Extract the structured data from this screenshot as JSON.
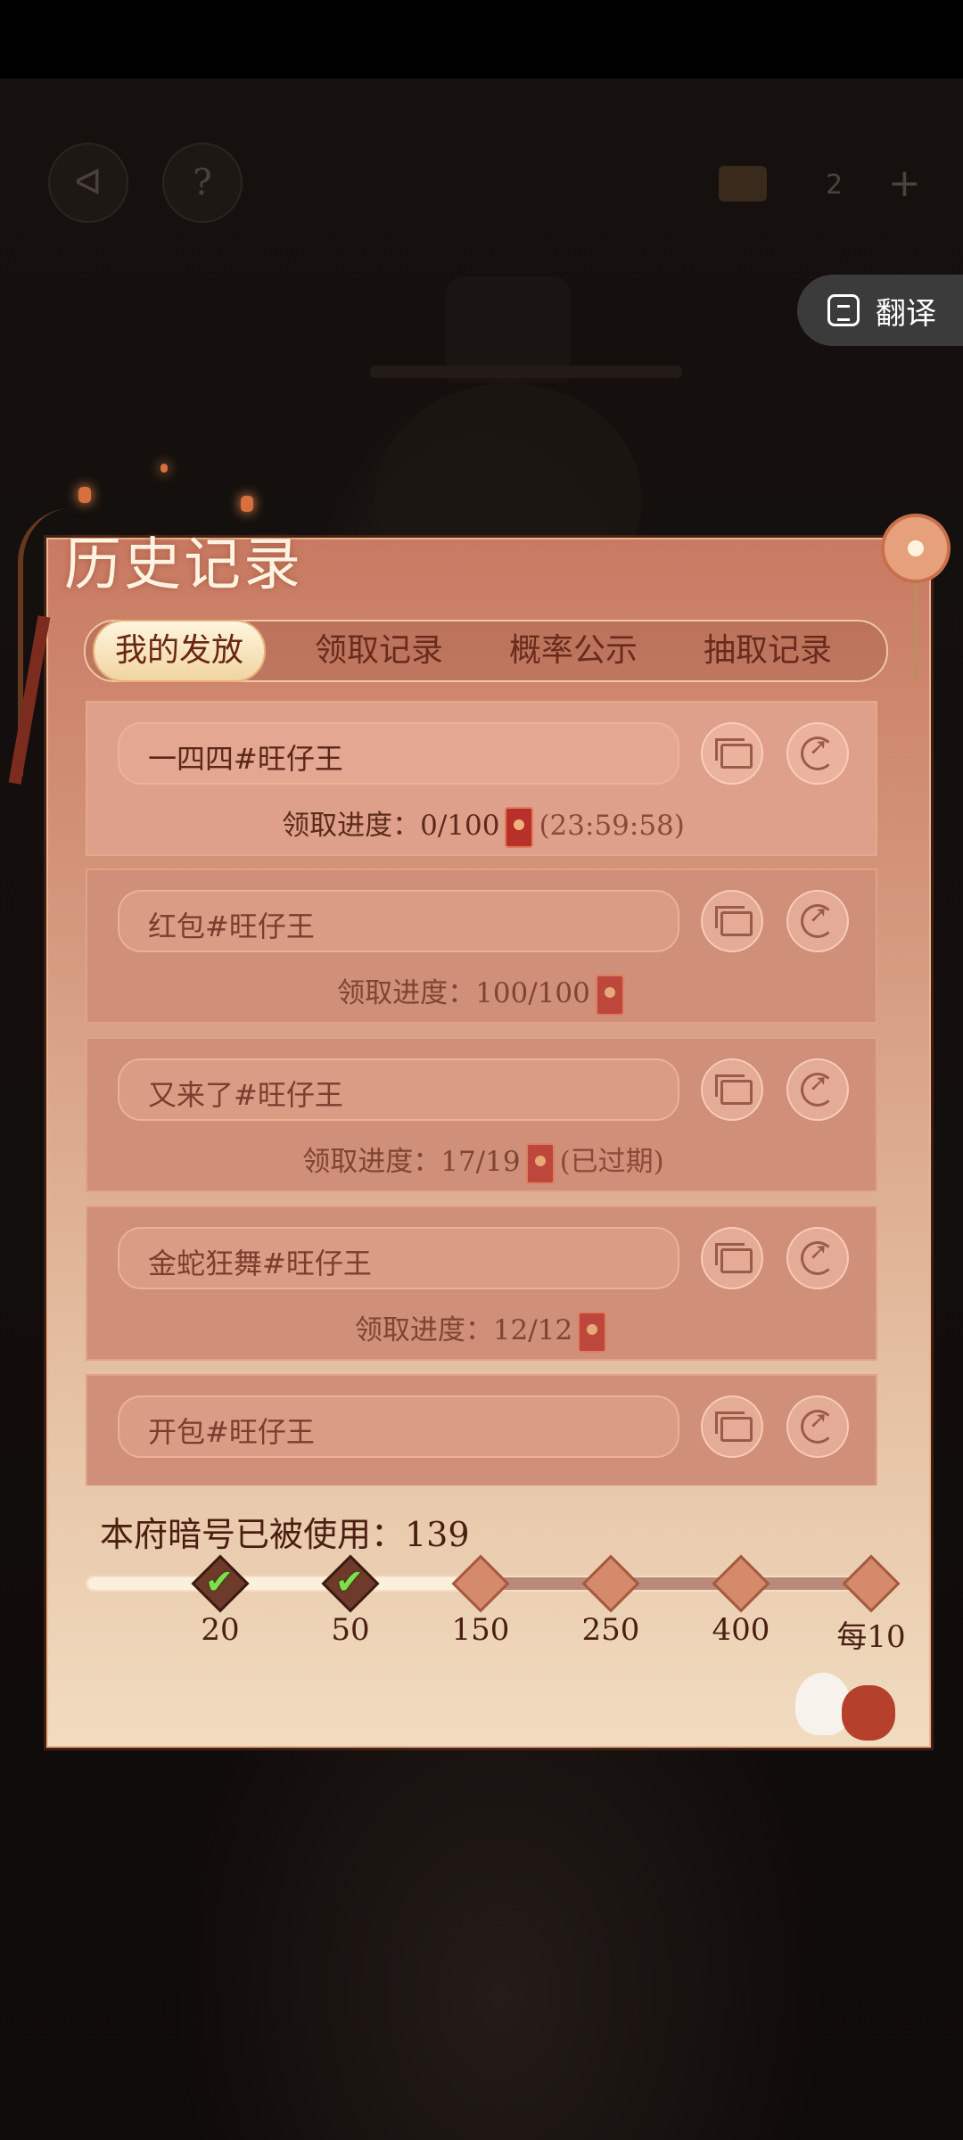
{
  "translate": {
    "label": "翻译"
  },
  "topbar": {
    "counter": "2",
    "back_glyph": "ᐊ",
    "help_glyph": "?",
    "plus_glyph": "+"
  },
  "title": "历史记录",
  "tabs": [
    {
      "label": "我的发放",
      "active": true
    },
    {
      "label": "领取记录",
      "active": false
    },
    {
      "label": "概率公示",
      "active": false
    },
    {
      "label": "抽取记录",
      "active": false
    }
  ],
  "records": [
    {
      "name": "一四四#旺仔王",
      "progress": "领取进度：0/100",
      "suffix": "(23:59:58)"
    },
    {
      "name": "红包#旺仔王",
      "progress": "领取进度：100/100",
      "suffix": ""
    },
    {
      "name": "又来了#旺仔王",
      "progress": "领取进度：17/19",
      "suffix": "(已过期)"
    },
    {
      "name": "金蛇狂舞#旺仔王",
      "progress": "领取进度：12/12",
      "suffix": ""
    },
    {
      "name": "开包#旺仔王",
      "progress": "",
      "suffix": ""
    }
  ],
  "usage": {
    "label": "本府暗号已被使用：139",
    "count": 139
  },
  "milestones": [
    {
      "label": "20",
      "reached": true
    },
    {
      "label": "50",
      "reached": true
    },
    {
      "label": "150",
      "reached": false
    },
    {
      "label": "250",
      "reached": false
    },
    {
      "label": "400",
      "reached": false
    },
    {
      "label": "每10",
      "reached": false
    }
  ],
  "check_glyph": "✔"
}
